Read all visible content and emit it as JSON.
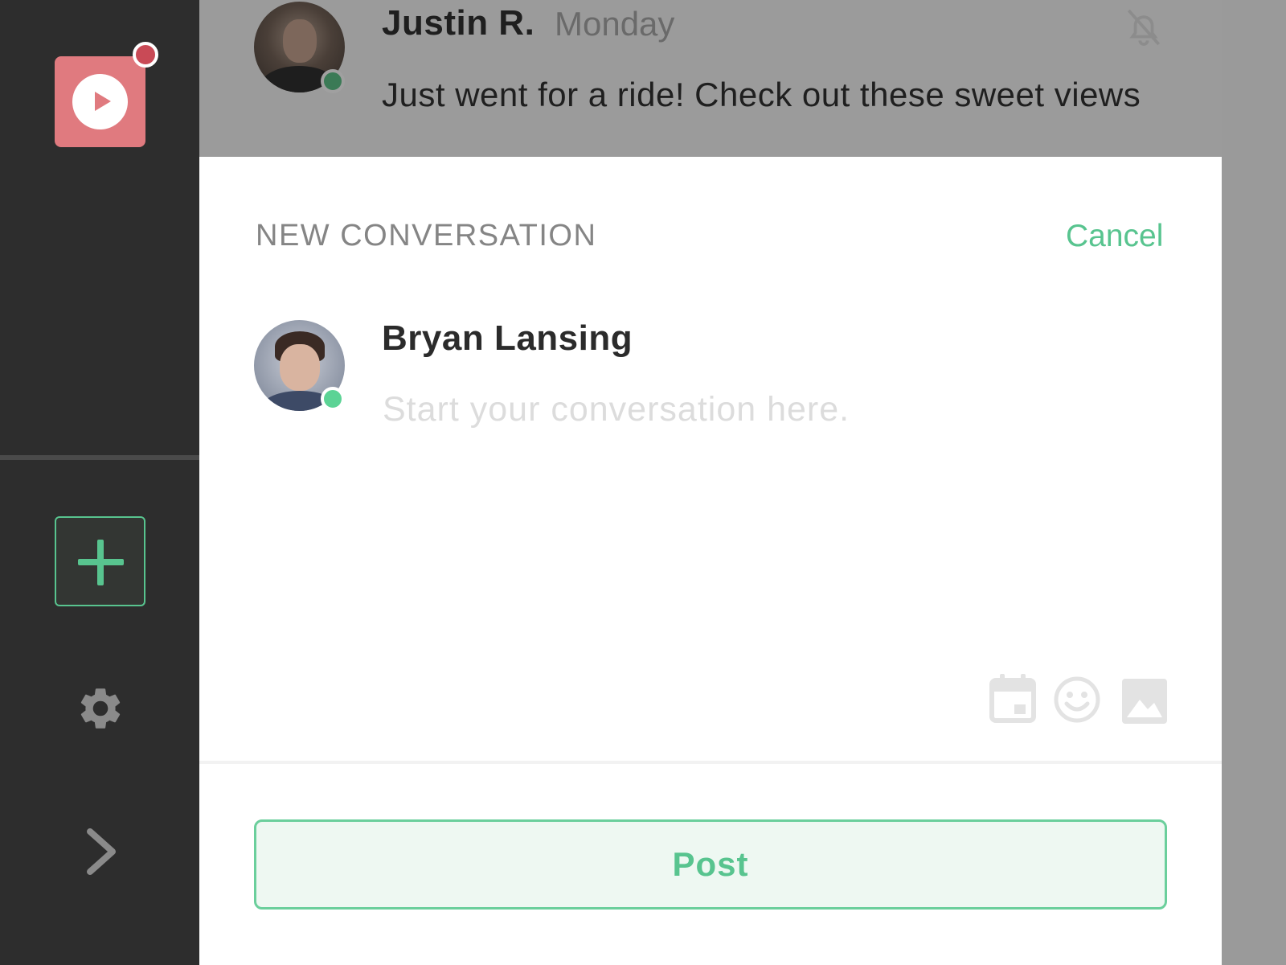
{
  "sidebar": {
    "logo_icon": "play-icon",
    "add_icon": "plus-icon",
    "settings_icon": "gear-icon",
    "expand_icon": "chevron-right-icon"
  },
  "background_conversation": {
    "author": "Justin R.",
    "time": "Monday",
    "message": "Just went for a ride! Check out these sweet views",
    "mute_icon": "bell-off-icon"
  },
  "new_conversation": {
    "title": "NEW CONVERSATION",
    "cancel_label": "Cancel",
    "recipient_name": "Bryan Lansing",
    "input_value": "",
    "input_placeholder": "Start your conversation here.",
    "tools": [
      "calendar-icon",
      "emoji-icon",
      "image-icon"
    ],
    "post_label": "Post"
  },
  "colors": {
    "accent": "#58c48f",
    "logo": "#e07a7f",
    "notification": "#c94a56",
    "sidebar": "#2d2d2d",
    "online": "#5cd395"
  }
}
